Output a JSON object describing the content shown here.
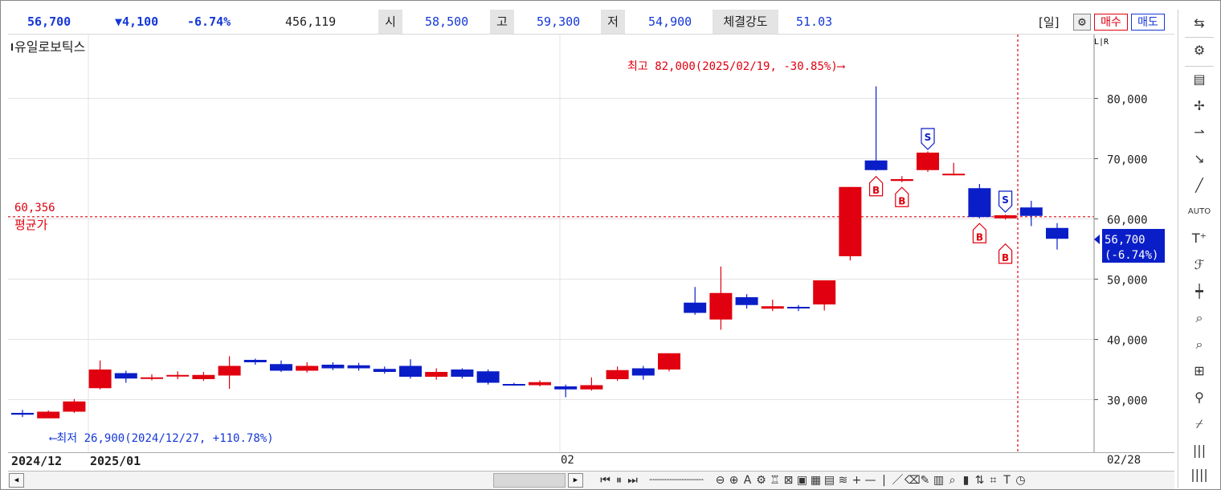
{
  "header": {
    "price": "56,700",
    "change": "▼4,100",
    "change_pct": "-6.74%",
    "volume": "456,119",
    "open_label": "시",
    "open": "58,500",
    "high_label": "고",
    "high": "59,300",
    "low_label": "저",
    "low": "54,900",
    "strength_label": "체결강도",
    "strength": "51.03",
    "period": "[일]",
    "buy_button": "매수",
    "sell_button": "매도"
  },
  "chart_labels": {
    "stock_name": "유일로보틱스",
    "scale_badge": "L|R",
    "high_note": "최고 82,000(2025/02/19, -30.85%)⟶",
    "low_note": "⟵최저 26,900(2024/12/27, +110.78%)",
    "avg_value": "60,356",
    "avg_label": "평균가",
    "current_price": "56,700",
    "current_pct": "(-6.74%)"
  },
  "date_axis": {
    "d1": "2024/12",
    "d2": "2025/01",
    "d3": "02",
    "d4": "02/28"
  },
  "colors": {
    "up": "#e0000f",
    "down": "#0a1ec8",
    "accent_blue": "#1538d6",
    "avg_line": "#e0000f"
  },
  "chart_data": {
    "type": "candlestick",
    "y_ticks": [
      30000,
      40000,
      50000,
      60000,
      70000,
      80000
    ],
    "y_tick_labels": [
      "30,000",
      "40,000",
      "50,000",
      "60,000",
      "70,000",
      "80,000"
    ],
    "ylim": [
      22800,
      87000
    ],
    "average_price": 60356,
    "candles": [
      {
        "o": 27800,
        "c": 27500,
        "h": 28300,
        "l": 27100
      },
      {
        "o": 26900,
        "c": 28000,
        "h": 28200,
        "l": 26900
      },
      {
        "o": 28000,
        "c": 29700,
        "h": 30100,
        "l": 27800
      },
      {
        "o": 31900,
        "c": 35000,
        "h": 36500,
        "l": 31700
      },
      {
        "o": 34400,
        "c": 33500,
        "h": 34800,
        "l": 32800
      },
      {
        "o": 33500,
        "c": 33700,
        "h": 34200,
        "l": 33200
      },
      {
        "o": 33900,
        "c": 34100,
        "h": 34700,
        "l": 33400
      },
      {
        "o": 33400,
        "c": 34100,
        "h": 34600,
        "l": 33100
      },
      {
        "o": 34000,
        "c": 35600,
        "h": 37200,
        "l": 31800
      },
      {
        "o": 36600,
        "c": 36200,
        "h": 36800,
        "l": 35800
      },
      {
        "o": 35900,
        "c": 34800,
        "h": 36500,
        "l": 34600
      },
      {
        "o": 34800,
        "c": 35600,
        "h": 36200,
        "l": 34500
      },
      {
        "o": 35800,
        "c": 35200,
        "h": 36200,
        "l": 34900
      },
      {
        "o": 35700,
        "c": 35200,
        "h": 36100,
        "l": 34800
      },
      {
        "o": 35100,
        "c": 34600,
        "h": 35500,
        "l": 34300
      },
      {
        "o": 35600,
        "c": 33800,
        "h": 36700,
        "l": 33500
      },
      {
        "o": 33800,
        "c": 34600,
        "h": 35200,
        "l": 33300
      },
      {
        "o": 35000,
        "c": 33800,
        "h": 35200,
        "l": 33500
      },
      {
        "o": 34700,
        "c": 32800,
        "h": 35000,
        "l": 32500
      },
      {
        "o": 32600,
        "c": 32500,
        "h": 32800,
        "l": 32300
      },
      {
        "o": 32400,
        "c": 32900,
        "h": 33200,
        "l": 32200
      },
      {
        "o": 32200,
        "c": 31700,
        "h": 32500,
        "l": 30400
      },
      {
        "o": 31700,
        "c": 32400,
        "h": 33700,
        "l": 31500
      },
      {
        "o": 33400,
        "c": 34900,
        "h": 35500,
        "l": 33100
      },
      {
        "o": 35200,
        "c": 34000,
        "h": 35600,
        "l": 33300
      },
      {
        "o": 35000,
        "c": 37700,
        "h": 37700,
        "l": 34700
      },
      {
        "o": 46100,
        "c": 44400,
        "h": 48700,
        "l": 44100
      },
      {
        "o": 43300,
        "c": 47700,
        "h": 52100,
        "l": 41600
      },
      {
        "o": 47000,
        "c": 45700,
        "h": 47500,
        "l": 45100
      },
      {
        "o": 45100,
        "c": 45500,
        "h": 46600,
        "l": 44700
      },
      {
        "o": 45400,
        "c": 45200,
        "h": 45700,
        "l": 44700
      },
      {
        "o": 45800,
        "c": 49800,
        "h": 49800,
        "l": 44800
      },
      {
        "o": 53800,
        "c": 65300,
        "h": 65300,
        "l": 53100
      },
      {
        "o": 69700,
        "c": 68100,
        "h": 82000,
        "l": 68000
      },
      {
        "o": 66300,
        "c": 66600,
        "h": 67100,
        "l": 66100
      },
      {
        "o": 68100,
        "c": 71000,
        "h": 71200,
        "l": 67800
      },
      {
        "o": 67400,
        "c": 67500,
        "h": 69300,
        "l": 67200
      },
      {
        "o": 65100,
        "c": 60300,
        "h": 65800,
        "l": 60100
      },
      {
        "o": 60100,
        "c": 60600,
        "h": 60700,
        "l": 59900
      },
      {
        "o": 61900,
        "c": 60500,
        "h": 63000,
        "l": 58800
      },
      {
        "o": 58500,
        "c": 56700,
        "h": 59300,
        "l": 54900
      }
    ],
    "signals": [
      {
        "candle": 33,
        "type": "B"
      },
      {
        "candle": 34,
        "type": "B"
      },
      {
        "candle": 35,
        "type": "S"
      },
      {
        "candle": 37,
        "type": "B"
      },
      {
        "candle": 38,
        "type": "S"
      },
      {
        "candle": 38,
        "type": "B"
      }
    ]
  }
}
